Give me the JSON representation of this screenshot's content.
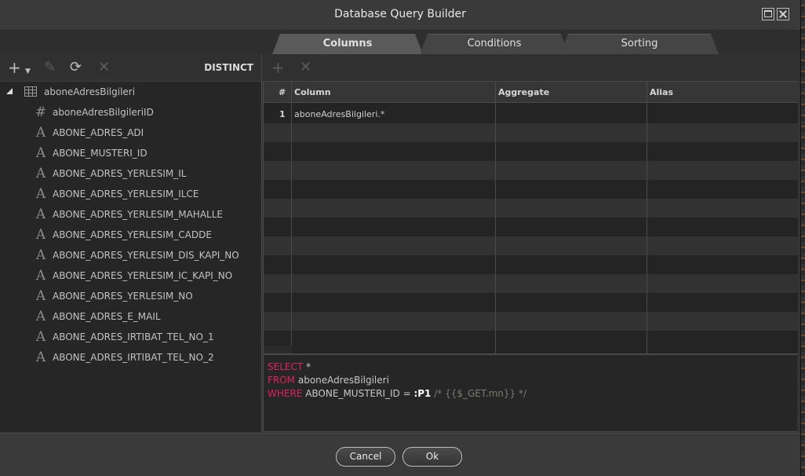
{
  "window": {
    "title": "Database Query Builder"
  },
  "tabs": [
    {
      "label": "Columns",
      "active": true
    },
    {
      "label": "Conditions",
      "active": false
    },
    {
      "label": "Sorting",
      "active": false
    }
  ],
  "left_toolbar": {
    "distinct_label": "DISTINCT"
  },
  "tree": {
    "table": "aboneAdresBilgileri",
    "fields": [
      {
        "name": "aboneAdresBilgileriID",
        "icon": "hash-icon",
        "glyph": "#"
      },
      {
        "name": "ABONE_ADRES_ADI",
        "icon": "text-field-icon",
        "glyph": "A"
      },
      {
        "name": "ABONE_MUSTERI_ID",
        "icon": "text-field-icon",
        "glyph": "A"
      },
      {
        "name": "ABONE_ADRES_YERLESIM_IL",
        "icon": "text-field-icon",
        "glyph": "A"
      },
      {
        "name": "ABONE_ADRES_YERLESIM_ILCE",
        "icon": "text-field-icon",
        "glyph": "A"
      },
      {
        "name": "ABONE_ADRES_YERLESIM_MAHALLE",
        "icon": "text-field-icon",
        "glyph": "A"
      },
      {
        "name": "ABONE_ADRES_YERLESIM_CADDE",
        "icon": "text-field-icon",
        "glyph": "A"
      },
      {
        "name": "ABONE_ADRES_YERLESIM_DIS_KAPI_NO",
        "icon": "text-field-icon",
        "glyph": "A"
      },
      {
        "name": "ABONE_ADRES_YERLESIM_IC_KAPI_NO",
        "icon": "text-field-icon",
        "glyph": "A"
      },
      {
        "name": "ABONE_ADRES_YERLESIM_NO",
        "icon": "text-field-icon",
        "glyph": "A"
      },
      {
        "name": "ABONE_ADRES_E_MAIL",
        "icon": "text-field-icon",
        "glyph": "A"
      },
      {
        "name": "ABONE_ADRES_IRTIBAT_TEL_NO_1",
        "icon": "text-field-icon",
        "glyph": "A"
      },
      {
        "name": "ABONE_ADRES_IRTIBAT_TEL_NO_2",
        "icon": "text-field-icon",
        "glyph": "A"
      }
    ]
  },
  "grid": {
    "headers": {
      "num": "#",
      "column": "Column",
      "aggregate": "Aggregate",
      "alias": "Alias"
    },
    "rows": [
      {
        "num": "1",
        "column": "aboneAdresBilgileri.*",
        "aggregate": "",
        "alias": ""
      }
    ]
  },
  "sql": {
    "line1": {
      "kw": "SELECT",
      "rest": " *"
    },
    "line2": {
      "kw": "FROM",
      "rest": " aboneAdresBilgileri"
    },
    "line3": {
      "kw": "WHERE",
      "rest": " ABONE_MUSTERI_ID = ",
      "param": ":P1",
      "comment": " /* {{$_GET.mn}} */"
    }
  },
  "buttons": {
    "cancel": "Cancel",
    "ok": "Ok"
  },
  "colors": {
    "keyword": "#e0245e",
    "background": "#262626",
    "panel": "#343434"
  }
}
